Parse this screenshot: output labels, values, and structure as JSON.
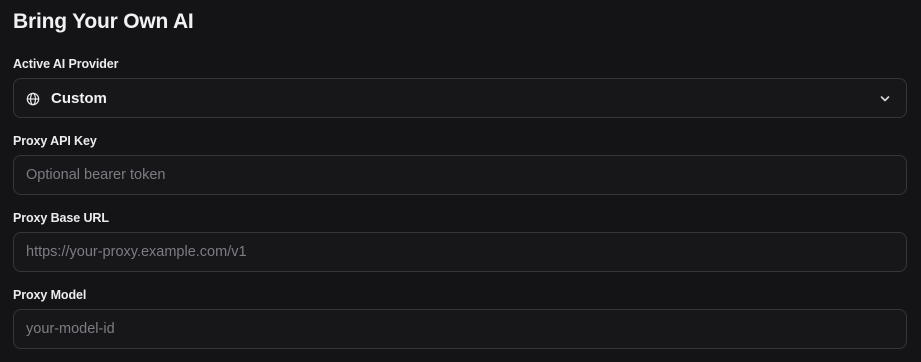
{
  "section": {
    "title": "Bring Your Own AI"
  },
  "provider": {
    "label": "Active AI Provider",
    "value": "Custom",
    "icon": "globe-icon"
  },
  "api_key": {
    "label": "Proxy API Key",
    "placeholder": "Optional bearer token",
    "value": ""
  },
  "base_url": {
    "label": "Proxy Base URL",
    "placeholder": "https://your-proxy.example.com/v1",
    "value": ""
  },
  "model": {
    "label": "Proxy Model",
    "placeholder": "your-model-id",
    "value": ""
  },
  "colors": {
    "background": "#141417",
    "field_background": "#17171a",
    "border": "#35353b",
    "text": "#ececef",
    "placeholder": "#7c7c84"
  }
}
